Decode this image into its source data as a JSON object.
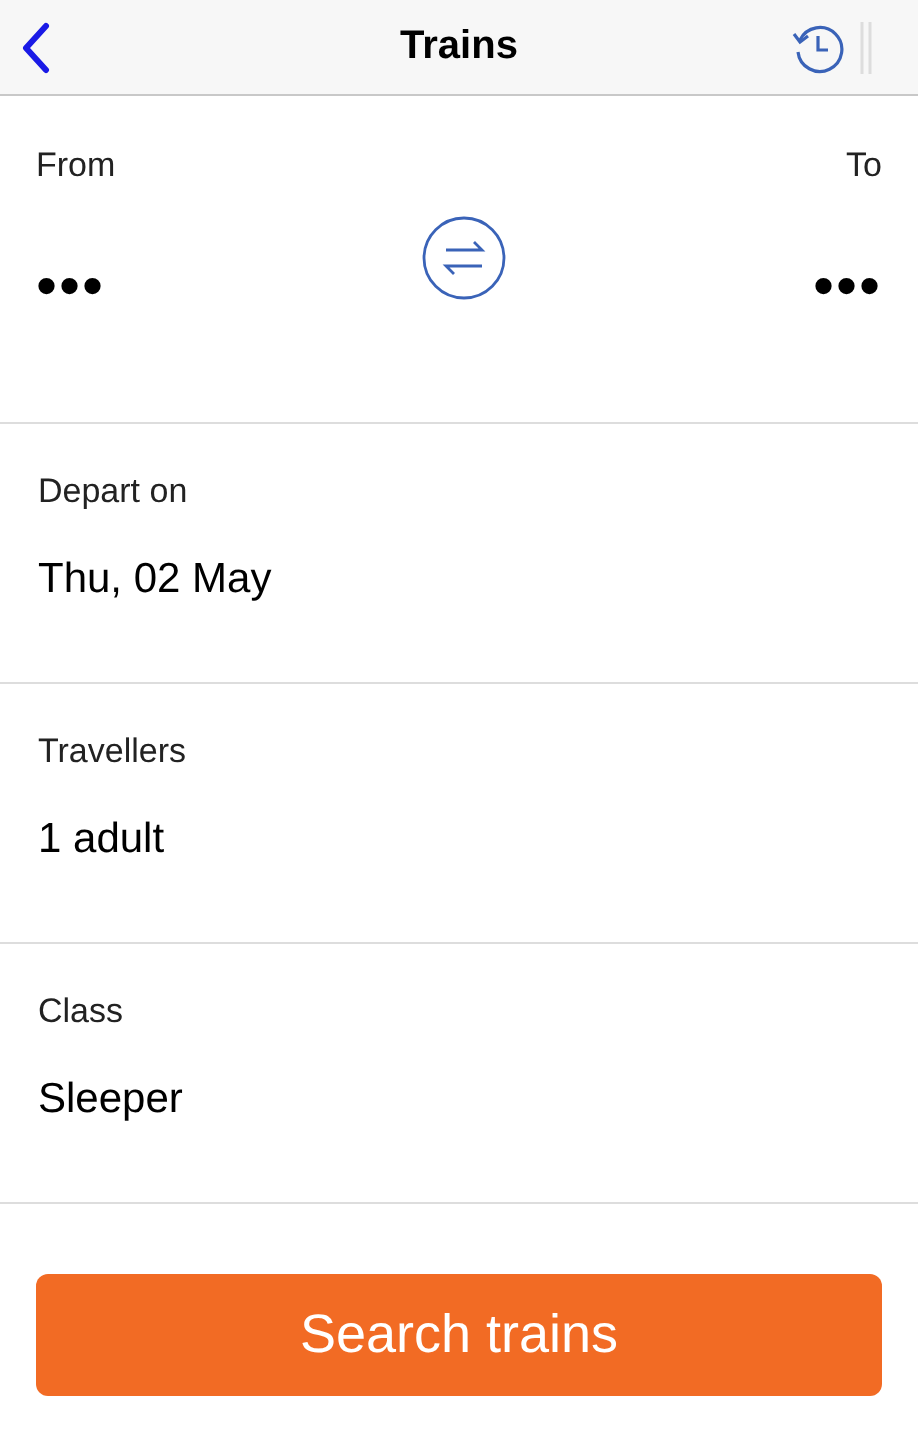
{
  "header": {
    "title": "Trains"
  },
  "route": {
    "from": {
      "label": "From",
      "value": "•••"
    },
    "to": {
      "label": "To",
      "value": "•••"
    }
  },
  "fields": [
    {
      "label": "Depart on",
      "value": "Thu, 02 May"
    },
    {
      "label": "Travellers",
      "value": "1 adult"
    },
    {
      "label": "Class",
      "value": "Sleeper"
    }
  ],
  "search_button": "Search trains"
}
